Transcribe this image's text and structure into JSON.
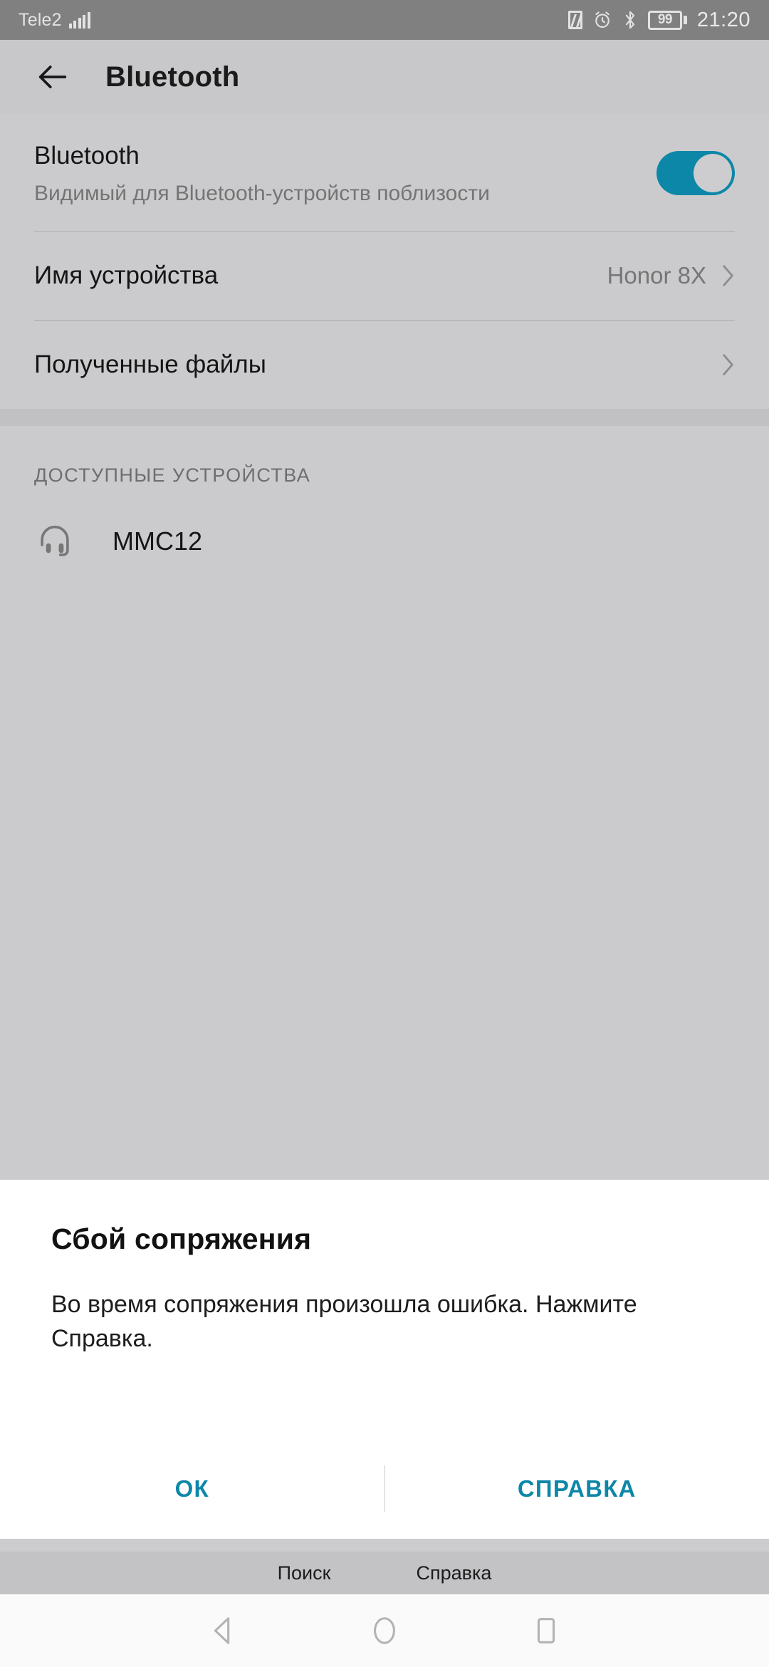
{
  "status_bar": {
    "carrier": "Tele2",
    "signal_icon": "signal-bars-icon",
    "nfc_icon": "nfc-icon",
    "alarm_icon": "alarm-clock-icon",
    "bluetooth_icon": "bluetooth-icon",
    "battery_level": "99",
    "time": "21:20"
  },
  "action_bar": {
    "back_icon": "back-arrow-icon",
    "title": "Bluetooth"
  },
  "settings": {
    "switch_row": {
      "title": "Bluetooth",
      "subtitle": "Видимый для Bluetooth-устройств поблизости",
      "toggle_state": "on",
      "toggle_color": "#0d87a7"
    },
    "rows": [
      {
        "label": "Имя устройства",
        "value": "Honor 8X",
        "chevron": "chevron-right-icon"
      },
      {
        "label": "Полученные файлы",
        "value": "",
        "chevron": "chevron-right-icon"
      }
    ]
  },
  "available_devices": {
    "header": "ДОСТУПНЫЕ УСТРОЙСТВА",
    "devices": [
      {
        "name": "MMC12",
        "icon": "headphones-icon"
      }
    ]
  },
  "dialog": {
    "title": "Сбой сопряжения",
    "message": "Во время сопряжения произошла ошибка. Нажмите Справка.",
    "buttons": [
      {
        "label": "ОК"
      },
      {
        "label": "СПРАВКА"
      }
    ],
    "accent_color": "#0d87a7"
  },
  "bottom_toolbar": {
    "items": [
      {
        "label": "Поиск"
      },
      {
        "label": "Справка"
      }
    ]
  },
  "nav_bar": {
    "back_icon": "nav-back-icon",
    "home_icon": "nav-home-icon",
    "recents_icon": "nav-recents-icon"
  }
}
